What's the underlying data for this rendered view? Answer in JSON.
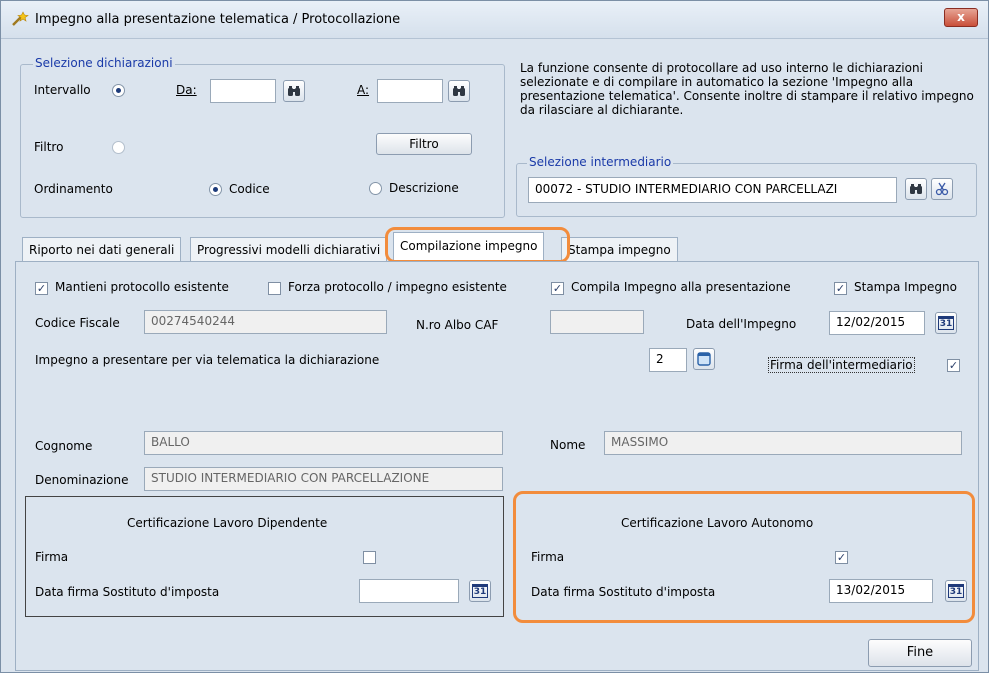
{
  "window": {
    "title": "Impegno alla presentazione telematica / Protocollazione",
    "close": "x"
  },
  "selezione": {
    "legend": "Selezione dichiarazioni",
    "intervallo": "Intervallo",
    "da_label": "Da:",
    "a_label": "A:",
    "da_value": "",
    "a_value": "",
    "filtro_label": "Filtro",
    "filtro_button": "Filtro",
    "ordinamento": "Ordinamento",
    "codice": "Codice",
    "descrizione": "Descrizione"
  },
  "info_text": "La funzione consente di protocollare ad uso interno le dichiarazioni selezionate e di compilare in automatico la sezione 'Impegno alla presentazione telematica'. Consente inoltre di stampare il relativo impegno da rilasciare al dichiarante.",
  "intermediario": {
    "legend": "Selezione intermediario",
    "value": "00072 - STUDIO INTERMEDIARIO CON PARCELLAZI"
  },
  "tabs": [
    {
      "label": "Riporto nei dati generali"
    },
    {
      "label": "Progressivi modelli dichiarativi"
    },
    {
      "label": "Compilazione impegno"
    },
    {
      "label": "Stampa impegno"
    }
  ],
  "options": {
    "mantieni": "Mantieni protocollo esistente",
    "forza": "Forza protocollo / impegno esistente",
    "compila": "Compila Impegno alla presentazione",
    "stampa": "Stampa Impegno"
  },
  "form": {
    "codice_fiscale_label": "Codice Fiscale",
    "codice_fiscale": "00274540244",
    "albo_label": "N.ro Albo CAF",
    "albo_value": "",
    "data_impegno_label": "Data dell'Impegno",
    "data_impegno": "12/02/2015",
    "impegno_label": "Impegno a presentare per via telematica la dichiarazione",
    "impegno_value": "2",
    "firma_intermediario": "Firma dell'intermediario",
    "cognome_label": "Cognome",
    "cognome": "BALLO",
    "nome_label": "Nome",
    "nome": "MASSIMO",
    "denominazione_label": "Denominazione",
    "denominazione": "STUDIO INTERMEDIARIO CON PARCELLAZIONE"
  },
  "dipendente": {
    "title": "Certificazione Lavoro Dipendente",
    "firma": "Firma",
    "data_label": "Data firma Sostituto d'imposta",
    "data_value": ""
  },
  "autonomo": {
    "title": "Certificazione Lavoro Autonomo",
    "firma": "Firma",
    "data_label": "Data firma Sostituto d'imposta",
    "data_value": "13/02/2015"
  },
  "fine_button": "Fine",
  "calendar_glyph": "31",
  "check_glyph": "✓",
  "colors": {
    "highlight": "#f28c3c",
    "legend": "#1a3aa8",
    "panel": "#dbe4ee"
  }
}
